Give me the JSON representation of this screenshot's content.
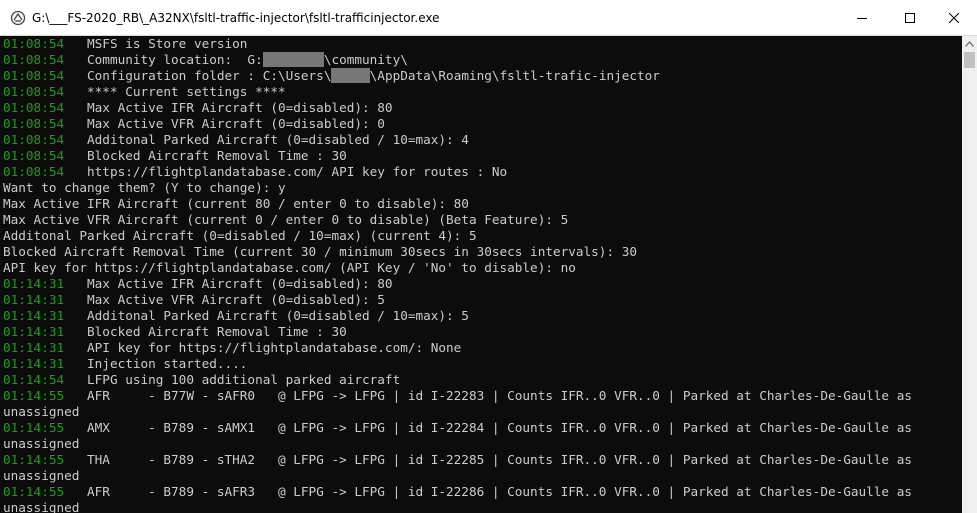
{
  "window": {
    "title": "G:\\___FS-2020_RB\\_A32NX\\fsltl-traffic-injector\\fsltl-trafficinjector.exe",
    "icon": "console-app-icon",
    "controls": [
      "minimize-icon",
      "maximize-icon",
      "close-icon"
    ]
  },
  "console": {
    "lines": [
      {
        "ts": "01:08:54",
        "text": "   MSFS is Store version"
      },
      {
        "ts": "01:08:54",
        "text": "   Community location:  G:",
        "redact": "████████",
        "after": "\\community\\"
      },
      {
        "ts": "01:08:54",
        "text": "   Configuration folder : C:\\Users\\",
        "redact": "█████",
        "after": "\\AppData\\Roaming\\fsltl-trafic-injector"
      },
      {
        "ts": "01:08:54",
        "text": "   **** Current settings ****"
      },
      {
        "ts": "01:08:54",
        "text": "   Max Active IFR Aircraft (0=disabled): 80"
      },
      {
        "ts": "01:08:54",
        "text": "   Max Active VFR Aircraft (0=disabled): 0"
      },
      {
        "ts": "01:08:54",
        "text": "   Additonal Parked Aircraft (0=disabled / 10=max): 4"
      },
      {
        "ts": "01:08:54",
        "text": "   Blocked Aircraft Removal Time : 30"
      },
      {
        "ts": "01:08:54",
        "text": "   https://flightplandatabase.com/ API key for routes : No"
      },
      {
        "ts": "",
        "text": "Want to change them? (Y to change): y"
      },
      {
        "ts": "",
        "text": "Max Active IFR Aircraft (current 80 / enter 0 to disable): 80"
      },
      {
        "ts": "",
        "text": "Max Active VFR Aircraft (current 0 / enter 0 to disable) (Beta Feature): 5"
      },
      {
        "ts": "",
        "text": "Additonal Parked Aircraft (0=disabled / 10=max) (current 4): 5"
      },
      {
        "ts": "",
        "text": "Blocked Aircraft Removal Time (current 30 / minimum 30secs in 30secs intervals): 30"
      },
      {
        "ts": "",
        "text": "API key for https://flightplandatabase.com/ (API Key / 'No' to disable): no"
      },
      {
        "ts": "01:14:31",
        "text": "   Max Active IFR Aircraft (0=disabled): 80"
      },
      {
        "ts": "01:14:31",
        "text": "   Max Active VFR Aircraft (0=disabled): 5"
      },
      {
        "ts": "01:14:31",
        "text": "   Additonal Parked Aircraft (0=disabled / 10=max): 5"
      },
      {
        "ts": "01:14:31",
        "text": "   Blocked Aircraft Removal Time : 30"
      },
      {
        "ts": "01:14:31",
        "text": "   API key for https://flightplandatabase.com/: None"
      },
      {
        "ts": "01:14:31",
        "text": "   Injection started...."
      },
      {
        "ts": "01:14:54",
        "text": "   LFPG using 100 additional parked aircraft"
      },
      {
        "ts": "01:14:55",
        "text": "   AFR     - B77W - sAFR0   @ LFPG -> LFPG | id I-22283 | Counts IFR..0 VFR..0 | Parked at Charles-De-Gaulle as"
      },
      {
        "ts": "",
        "text": "unassigned"
      },
      {
        "ts": "01:14:55",
        "text": "   AMX     - B789 - sAMX1   @ LFPG -> LFPG | id I-22284 | Counts IFR..0 VFR..0 | Parked at Charles-De-Gaulle as"
      },
      {
        "ts": "",
        "text": "unassigned"
      },
      {
        "ts": "01:14:55",
        "text": "   THA     - B789 - sTHA2   @ LFPG -> LFPG | id I-22285 | Counts IFR..0 VFR..0 | Parked at Charles-De-Gaulle as"
      },
      {
        "ts": "",
        "text": "unassigned"
      },
      {
        "ts": "01:14:55",
        "text": "   AFR     - B789 - sAFR3   @ LFPG -> LFPG | id I-22286 | Counts IFR..0 VFR..0 | Parked at Charles-De-Gaulle as"
      },
      {
        "ts": "",
        "text": "unassigned"
      }
    ]
  }
}
